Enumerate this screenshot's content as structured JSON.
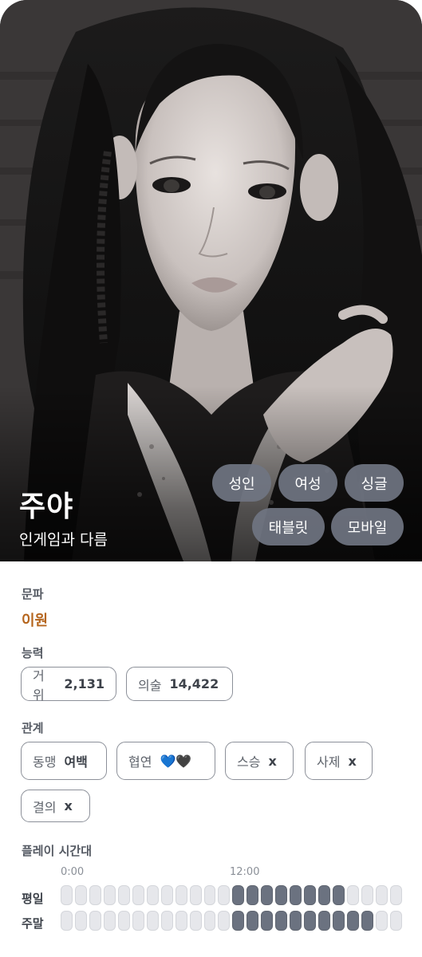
{
  "profile": {
    "name": "주야",
    "subtitle": "인게임과 다름",
    "tags": [
      "성인",
      "여성",
      "싱글",
      "태블릿",
      "모바일"
    ]
  },
  "faction": {
    "label": "문파",
    "value": "이원"
  },
  "ability": {
    "label": "능력",
    "items": [
      {
        "key": "거위",
        "value": "2,131"
      },
      {
        "key": "의술",
        "value": "14,422"
      }
    ]
  },
  "relations": {
    "label": "관계",
    "items": [
      {
        "key": "동맹",
        "value": "여백"
      },
      {
        "key": "협연",
        "value": "💙🖤"
      },
      {
        "key": "스승",
        "value": "x"
      },
      {
        "key": "사제",
        "value": "x"
      },
      {
        "key": "결의",
        "value": "x"
      }
    ]
  },
  "playtime": {
    "label": "플레이 시간대",
    "time_markers": [
      "0:00",
      "12:00"
    ],
    "rows": [
      {
        "label": "평일",
        "active": [
          0,
          0,
          0,
          0,
          0,
          0,
          0,
          0,
          0,
          0,
          0,
          0,
          1,
          1,
          1,
          1,
          1,
          1,
          1,
          1,
          0,
          0,
          0,
          0
        ]
      },
      {
        "label": "주말",
        "active": [
          0,
          0,
          0,
          0,
          0,
          0,
          0,
          0,
          0,
          0,
          0,
          0,
          1,
          1,
          1,
          1,
          1,
          1,
          1,
          1,
          1,
          1,
          0,
          0
        ]
      }
    ]
  },
  "colors": {
    "accent": "#b5651d",
    "tag_bg": "#707582",
    "bar_on": "#6b7280",
    "bar_off": "#e6e7eb"
  }
}
